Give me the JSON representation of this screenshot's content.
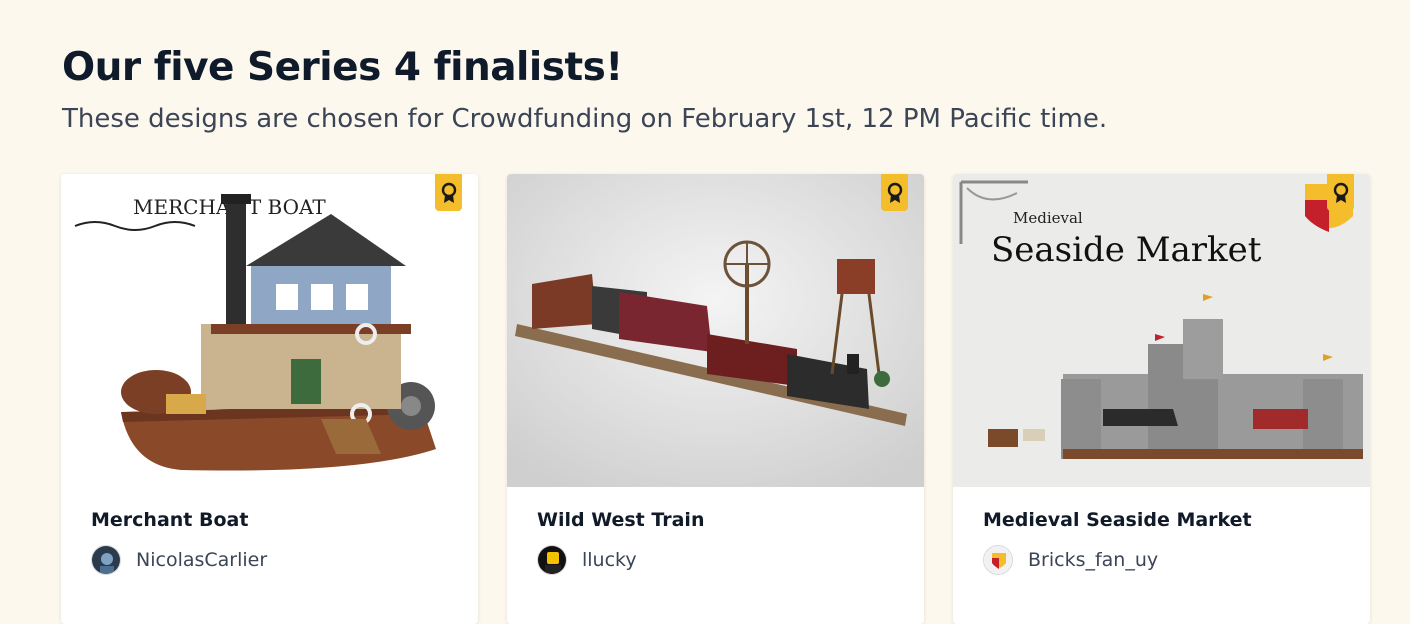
{
  "header": {
    "title": "Our five Series 4 finalists!",
    "subtitle": "These designs are chosen for Crowdfunding on February 1st, 12 PM Pacific time."
  },
  "cards": [
    {
      "title": "Merchant Boat",
      "author": "NicolasCarlier",
      "image_caption": "MERCHANT BOAT",
      "icon": "award-ribbon-icon"
    },
    {
      "title": "Wild West Train",
      "author": "llucky",
      "icon": "award-ribbon-icon"
    },
    {
      "title": "Medieval Seaside Market",
      "author": "Bricks_fan_uy",
      "image_caption_top": "Medieval",
      "image_caption_main": "Seaside Market",
      "icon": "award-ribbon-icon"
    }
  ],
  "colors": {
    "page_background": "#fdf8ee",
    "badge": "#f4bd2b",
    "title_text": "#0f1b2b",
    "subtitle_text": "#3b4556"
  }
}
